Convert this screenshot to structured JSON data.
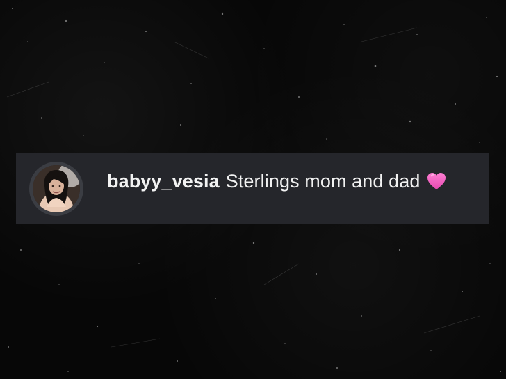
{
  "comment": {
    "username": "babyy_vesia",
    "text": "Sterlings mom and dad",
    "emoji_icon": "pink-heart-icon"
  },
  "colors": {
    "background": "#070707",
    "comment_bar": "#25262b",
    "text": "#f2f2f2",
    "heart": "#f25cc0"
  }
}
